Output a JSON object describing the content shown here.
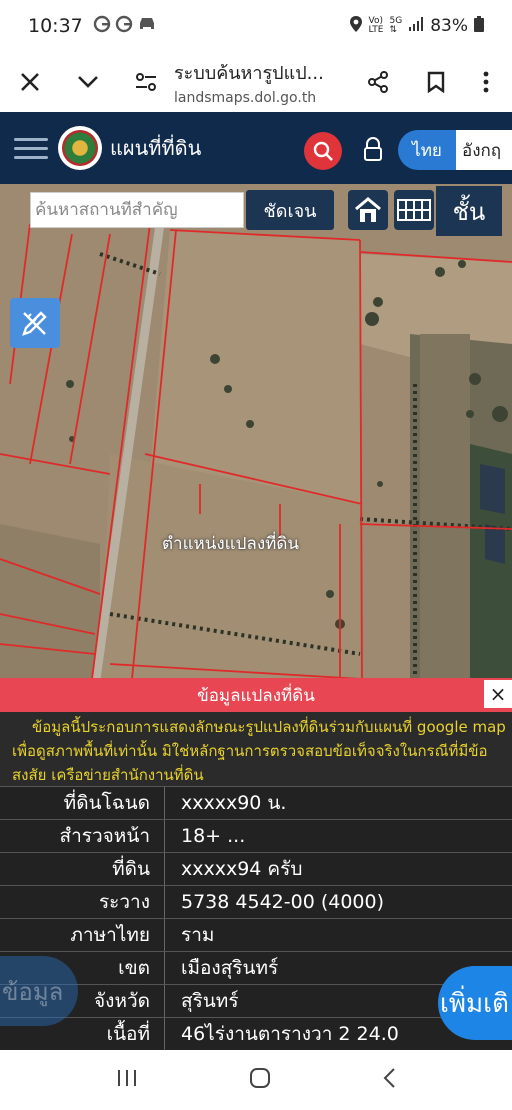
{
  "status_bar": {
    "time": "10:37",
    "left_icons": [
      "google-g-icon",
      "google-g-icon",
      "car-icon"
    ],
    "right_icons": [
      "location-icon",
      "volte-icon",
      "5g-icon",
      "signal-icon"
    ],
    "battery": "83%"
  },
  "browser": {
    "title": "ระบบค้นหารูปแป...",
    "url": "landsmaps.dol.go.th"
  },
  "app": {
    "name": "แผนที่ที่ดิน",
    "lang_th": "ไทย",
    "lang_en": "อังกฤ"
  },
  "map": {
    "search_placeholder": "ค้นหาสถานที่สำคัญ",
    "clear_label": "ชัดเจน",
    "layer_label": "ชั้น",
    "parcel_label": "ตำแหน่งแปลงที่ดิน"
  },
  "panel": {
    "header": "ข้อมูลแปลงที่ดิน",
    "close": "×",
    "note": "ข้อมูลนี้ประกอบการแสดงลักษณะรูปแปลงที่ดินร่วมกับแผนที่ google map เพื่อดูสภาพพื้นที่เท่านั้น มิใช่หลักฐานการตรวจสอบข้อเท็จจริงในกรณีที่มีข้อสงสัย เครือข่ายสำนักงานที่ดิน",
    "rows": [
      {
        "key": "ที่ดินโฉนด",
        "value": "xxxxx90 น."
      },
      {
        "key": "สำรวจหน้า",
        "value": "18+ ..."
      },
      {
        "key": "ที่ดิน",
        "value": "xxxxx94 ครับ"
      },
      {
        "key": "ระวาง",
        "value": "5738 4542-00 (4000)"
      },
      {
        "key": "ภาษาไทย",
        "value": "ราม"
      },
      {
        "key": "เขต",
        "value": "เมืองสุรินทร์"
      },
      {
        "key": "จังหวัด",
        "value": "สุรินทร์"
      },
      {
        "key": "เนื้อที่",
        "value": "46ไร่งานตารางวา 2 24.0"
      }
    ],
    "more_button": "เพิ่มเติ",
    "left_floating": "ข้อมูล"
  },
  "colors": {
    "header_bg": "#0f2a4a",
    "accent_red": "#e84652",
    "note_text": "#e8d22d",
    "accent_blue": "#1d85e6"
  }
}
